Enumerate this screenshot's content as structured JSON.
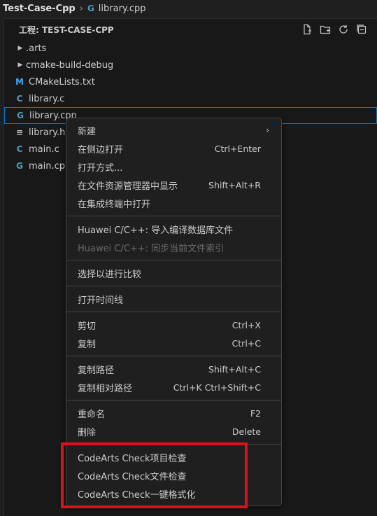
{
  "breadcrumb": {
    "root": "Test-Case-Cpp",
    "file": "library.cpp"
  },
  "explorer": {
    "title": "工程: TEST-CASE-CPP",
    "actions": [
      "new-file-icon",
      "new-folder-icon",
      "refresh-icon",
      "collapse-all-icon"
    ],
    "items": [
      {
        "label": ".arts",
        "kind": "folder"
      },
      {
        "label": "cmake-build-debug",
        "kind": "folder"
      },
      {
        "label": "CMakeLists.txt",
        "kind": "cmake",
        "icon_char": "M"
      },
      {
        "label": "library.c",
        "kind": "c",
        "icon_char": "C"
      },
      {
        "label": "library.cpp",
        "kind": "cpp",
        "icon_char": "G"
      },
      {
        "label": "library.h",
        "kind": "txt",
        "icon_char": "≡"
      },
      {
        "label": "main.c",
        "kind": "c",
        "icon_char": "C"
      },
      {
        "label": "main.cpp",
        "kind": "cpp",
        "icon_char": "G"
      }
    ]
  },
  "context_menu": {
    "groups": [
      [
        {
          "label": "新建",
          "shortcut": "",
          "submenu": true
        },
        {
          "label": "在侧边打开",
          "shortcut": "Ctrl+Enter"
        },
        {
          "label": "打开方式...",
          "shortcut": ""
        },
        {
          "label": "在文件资源管理器中显示",
          "shortcut": "Shift+Alt+R"
        },
        {
          "label": "在集成终端中打开",
          "shortcut": ""
        }
      ],
      [
        {
          "label": "Huawei C/C++: 导入编译数据库文件",
          "shortcut": ""
        },
        {
          "label": "Huawei C/C++: 同步当前文件索引",
          "shortcut": "",
          "disabled": true
        }
      ],
      [
        {
          "label": "选择以进行比较",
          "shortcut": ""
        }
      ],
      [
        {
          "label": "打开时间线",
          "shortcut": ""
        }
      ],
      [
        {
          "label": "剪切",
          "shortcut": "Ctrl+X"
        },
        {
          "label": "复制",
          "shortcut": "Ctrl+C"
        }
      ],
      [
        {
          "label": "复制路径",
          "shortcut": "Shift+Alt+C"
        },
        {
          "label": "复制相对路径",
          "shortcut": "Ctrl+K Ctrl+Shift+C"
        }
      ],
      [
        {
          "label": "重命名",
          "shortcut": "F2"
        },
        {
          "label": "删除",
          "shortcut": "Delete"
        }
      ],
      [
        {
          "label": "CodeArts Check项目检查",
          "shortcut": ""
        },
        {
          "label": "CodeArts Check文件检查",
          "shortcut": ""
        },
        {
          "label": "CodeArts Check一键格式化",
          "shortcut": ""
        }
      ]
    ]
  },
  "colors": {
    "accent": "#0078d4",
    "highlight": "#e0101a"
  }
}
